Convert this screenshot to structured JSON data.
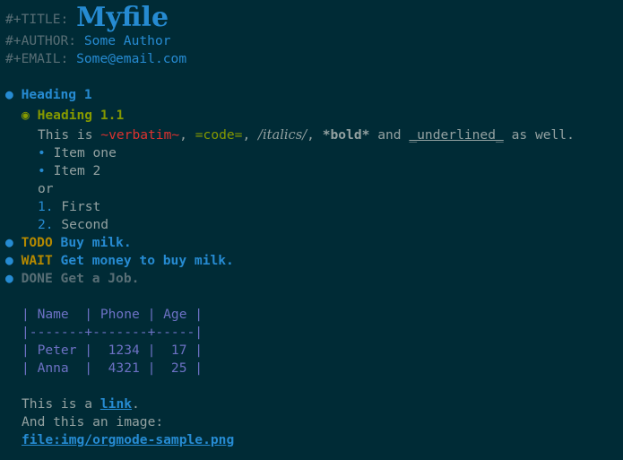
{
  "meta": {
    "title_keyword": "#+TITLE:",
    "title_value": "Myfile",
    "author_keyword": "#+AUTHOR:",
    "author_value": "Some Author",
    "email_keyword": "#+EMAIL:",
    "email_value": "Some@email.com"
  },
  "outline": {
    "bullet": "●",
    "sub_bullet": "◉",
    "heading1": "Heading 1",
    "heading11": "Heading 1.1"
  },
  "paragraph": {
    "t1": "This is ",
    "verbatim": "~verbatim~",
    "t2": ", ",
    "code": "=code=",
    "t3": ", ",
    "italics": "/italics/",
    "t4": ", ",
    "bold": "*bold*",
    "t5": " and ",
    "underlined": "_underlined_",
    "t6": " as well."
  },
  "lists": {
    "dot": "•",
    "unordered": [
      "Item one",
      "Item 2"
    ],
    "or": "or",
    "ordered_nums": [
      "1.",
      "2."
    ],
    "ordered": [
      "First",
      "Second"
    ]
  },
  "tasks": [
    {
      "keyword": "TODO",
      "text": "Buy milk."
    },
    {
      "keyword": "WAIT",
      "text": "Get money to buy milk."
    },
    {
      "keyword": "DONE",
      "text": "Get a Job."
    }
  ],
  "table": {
    "rows": [
      "| Name  | Phone | Age |",
      "|-------+-------+-----|",
      "| Peter |  1234 |  17 |",
      "| Anna  |  4321 |  25 |"
    ]
  },
  "footer": {
    "link_prefix": "This is a ",
    "link_text": "link",
    "link_suffix": ".",
    "image_line": "And this an image:",
    "image_link": "file:img/orgmode-sample.png"
  },
  "colors": {
    "background": "#002b36",
    "blue": "#268bd2",
    "green": "#859900",
    "yellow": "#b58900",
    "red": "#dc322f",
    "violet": "#6c71c4",
    "comment": "#586e75",
    "text": "#93a1a1"
  }
}
